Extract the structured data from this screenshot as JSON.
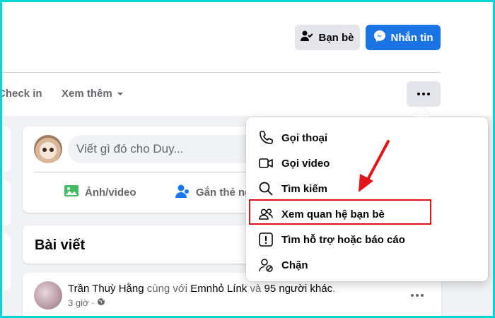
{
  "header": {
    "friends_button": "Bạn bè",
    "message_button": "Nhắn tin"
  },
  "tabs": {
    "checkin": "Check in",
    "more": "Xem thêm"
  },
  "composer": {
    "placeholder": "Viết gì đó cho Duy...",
    "photo_video": "Ảnh/video",
    "tag_people": "Gắn thẻ ng"
  },
  "posts": {
    "title": "Bài viết"
  },
  "post": {
    "author": "Trần Thuỳ Hằng",
    "with_text": " cùng với ",
    "tagged": "Emnhỏ Línk",
    "and_text": " và ",
    "others": "95 người khác",
    "period": ".",
    "time": "3 giờ ·"
  },
  "menu": {
    "items": [
      {
        "label": "Gọi thoại",
        "icon": "phone-icon"
      },
      {
        "label": "Gọi video",
        "icon": "video-camera-icon"
      },
      {
        "label": "Tìm kiếm",
        "icon": "search-icon"
      },
      {
        "label": "Xem quan hệ bạn bè",
        "icon": "friends-icon"
      },
      {
        "label": "Tìm hỗ trợ hoặc báo cáo",
        "icon": "report-icon"
      },
      {
        "label": "Chặn",
        "icon": "block-user-icon"
      }
    ]
  },
  "colors": {
    "accent_blue": "#1b74e4",
    "annotation_red": "#e3131b",
    "frame_cyan": "#00d5d5"
  }
}
